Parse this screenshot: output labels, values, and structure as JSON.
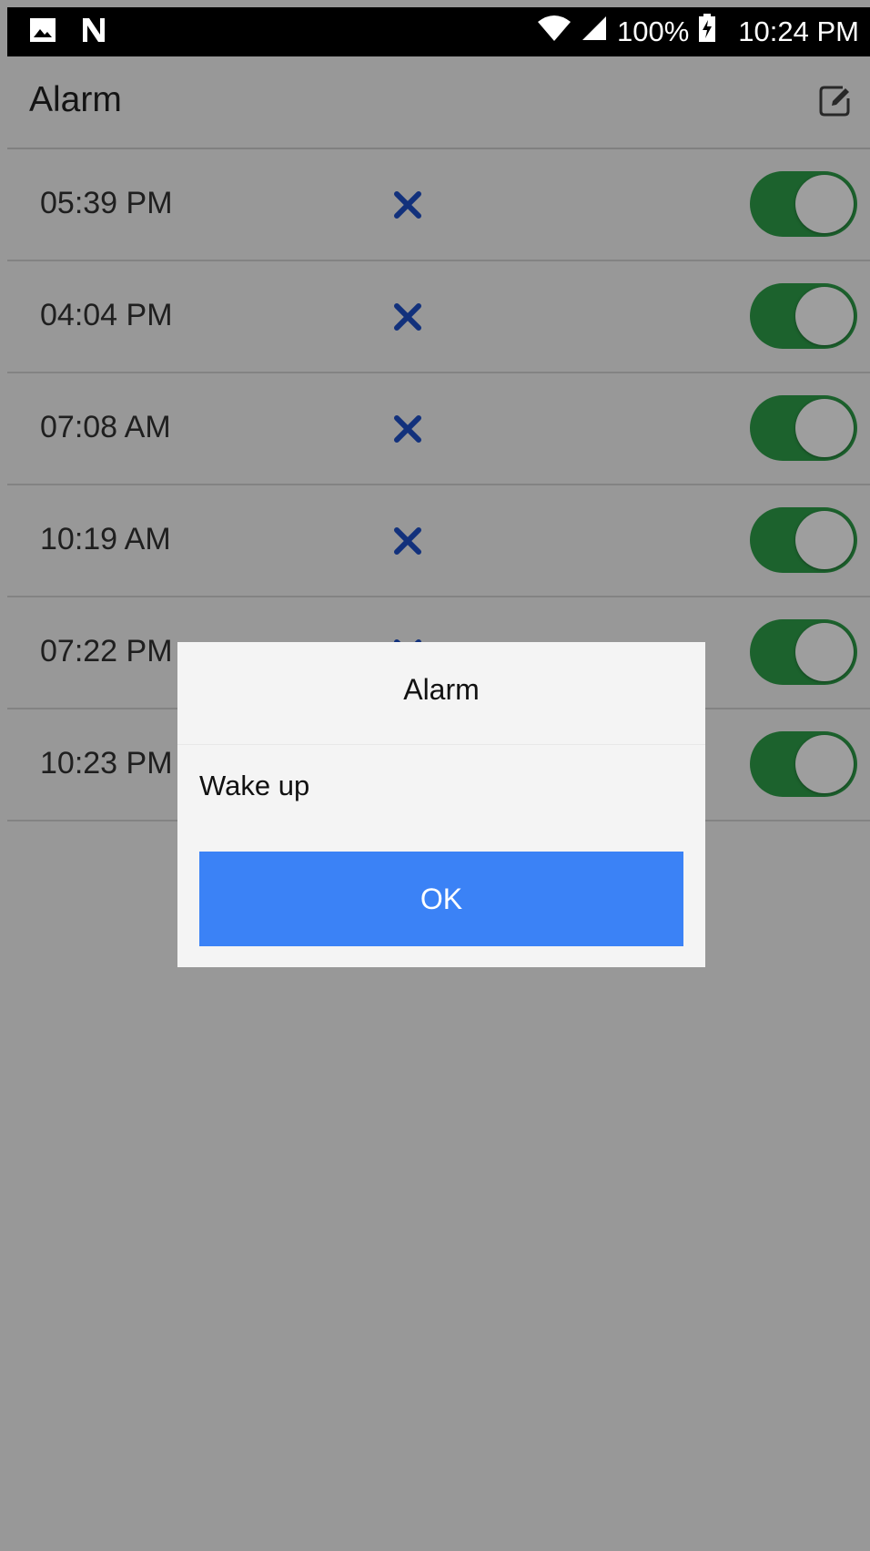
{
  "status_bar": {
    "battery": "100%",
    "time": "10:24 PM",
    "icons": [
      "image-icon",
      "n-notification-icon",
      "wifi-icon",
      "cellular-signal-icon",
      "battery-charging-icon"
    ]
  },
  "app_bar": {
    "title": "Alarm",
    "edit_icon": "edit-icon"
  },
  "alarms": [
    {
      "time": "05:39 PM",
      "enabled": true
    },
    {
      "time": "04:04 PM",
      "enabled": true
    },
    {
      "time": "07:08 AM",
      "enabled": true
    },
    {
      "time": "10:19 AM",
      "enabled": true
    },
    {
      "time": "07:22 PM",
      "enabled": true
    },
    {
      "time": "10:23 PM",
      "enabled": true
    }
  ],
  "dialog": {
    "title": "Alarm",
    "message": "Wake up",
    "ok_label": "OK"
  },
  "colors": {
    "toggle_on": "#2e9e49",
    "delete_icon": "#1e4fc9",
    "ok_button": "#3b82f6",
    "status_bar": "#000000"
  }
}
